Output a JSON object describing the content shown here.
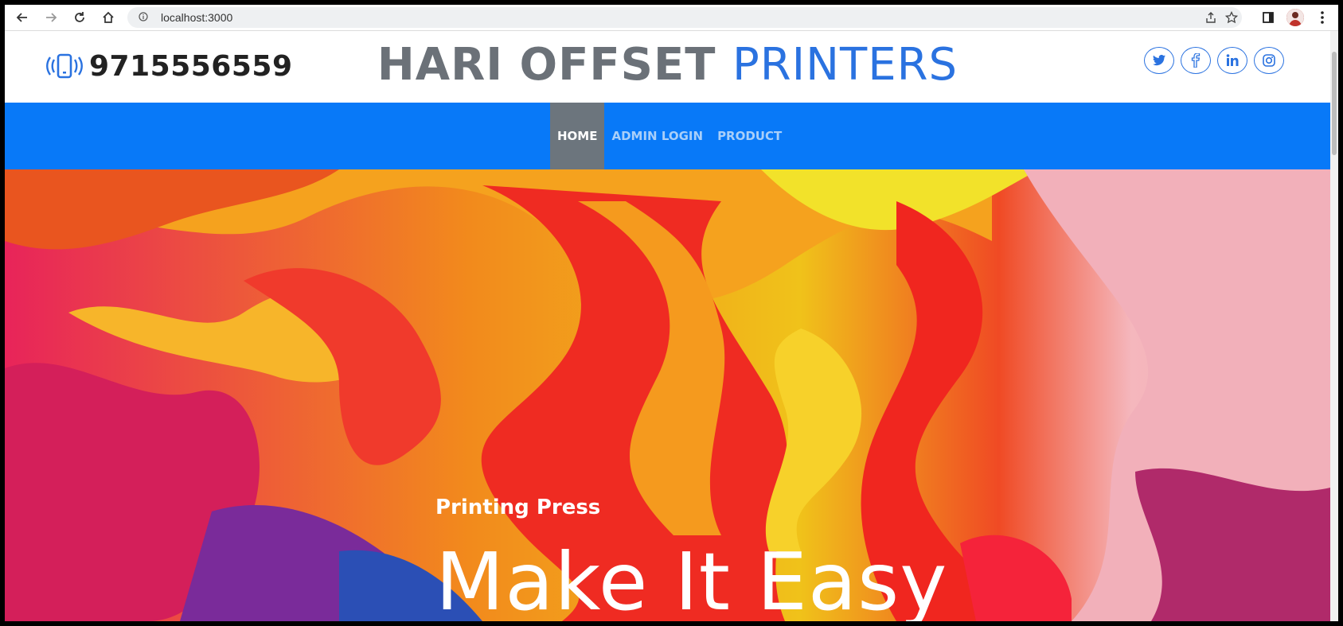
{
  "browser": {
    "url": "localhost:3000"
  },
  "header": {
    "phone": "9715556559",
    "brand_part1": "HARI OFFSET",
    "brand_part2": "PRINTERS",
    "socials": [
      {
        "name": "twitter-icon"
      },
      {
        "name": "facebook-icon"
      },
      {
        "name": "linkedin-icon"
      },
      {
        "name": "instagram-icon"
      }
    ]
  },
  "nav": {
    "items": [
      {
        "label": "HOME",
        "active": true
      },
      {
        "label": "ADMIN LOGIN",
        "active": false
      },
      {
        "label": "PRODUCT",
        "active": false
      }
    ]
  },
  "hero": {
    "kicker": "Printing Press",
    "title": "Make It Easy"
  },
  "colors": {
    "brand_blue": "#2a72e0",
    "nav_blue": "#0879f8",
    "nav_active": "#6c757d",
    "brand_gray": "#6b7178"
  }
}
